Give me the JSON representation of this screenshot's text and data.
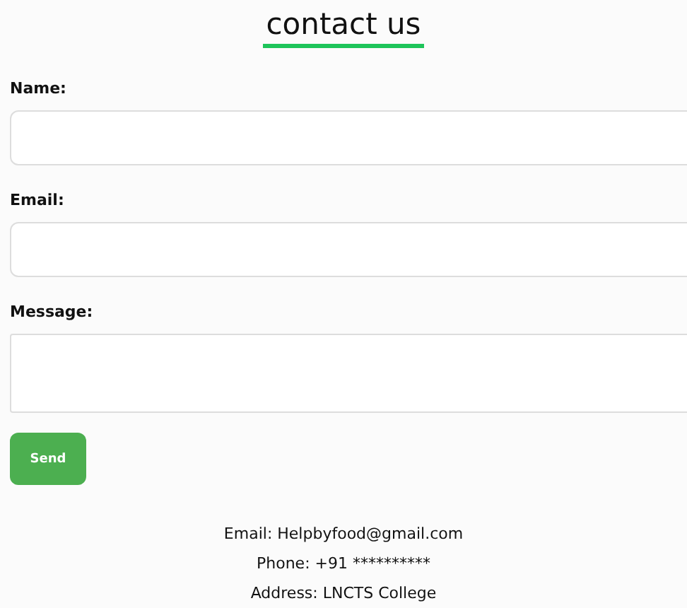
{
  "title": "contact us",
  "fields": [
    {
      "label": "Name:",
      "kind": "input"
    },
    {
      "label": "Email:",
      "kind": "input"
    },
    {
      "label": "Message:",
      "kind": "textarea"
    }
  ],
  "button": "Send",
  "footer": [
    "Email: Helpbyfood@gmail.com",
    "Phone: +91 **********",
    "Address: LNCTS College"
  ]
}
